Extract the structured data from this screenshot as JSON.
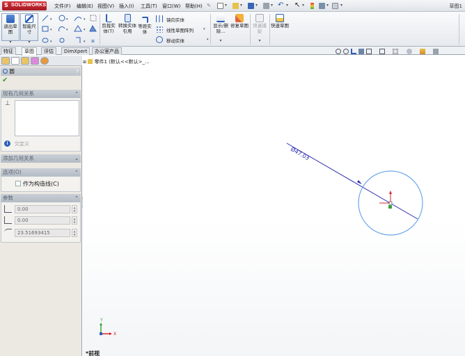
{
  "app": {
    "logo_text": "SOLIDWORKS",
    "window_title": "草图1"
  },
  "menu": {
    "items": [
      "文件(F)",
      "编辑(E)",
      "视图(V)",
      "插入(I)",
      "工具(T)",
      "窗口(W)",
      "帮助(H)"
    ]
  },
  "commands": {
    "exit_sketch": "退出草图",
    "smart_dim": "智能尺寸",
    "trim": "剪裁实体(T)",
    "convert": "转换实体引用",
    "offset": "等距实体",
    "mirror": "镜向实体",
    "linear_pattern": "线性草图阵列",
    "move": "移动实体",
    "display_delete": "显示/删除...",
    "repair": "修复草图",
    "quick_snaps": "快速捕捉",
    "rapid_sketch": "快速草图"
  },
  "tabs": [
    "特征",
    "草图",
    "评估",
    "DimXpert",
    "办公室产品"
  ],
  "active_tab": "草图",
  "tree": {
    "root_label": "零件1  (默认<<默认>_..."
  },
  "property_manager": {
    "title": "圆",
    "help": "?",
    "existing_relations_title": "现有几何关系",
    "status_text": "欠定义",
    "add_relations_title": "添加几何关系",
    "options_title": "选项(O)",
    "construction_label": "作为构造线(C)",
    "construction_checked": false,
    "params_title": "参数",
    "param_x": "0.00",
    "param_y": "0.00",
    "param_radius": "23.51693415"
  },
  "graphics": {
    "dimension_text": "Ø47.03",
    "view_label": "*前视",
    "triad_x": "X",
    "triad_y": "Y"
  },
  "colors": {
    "accent_blue": "#2f6fd6",
    "circle": "#6aa6ea",
    "dimension": "#2a2ab0",
    "brand_red": "#c4262e"
  }
}
